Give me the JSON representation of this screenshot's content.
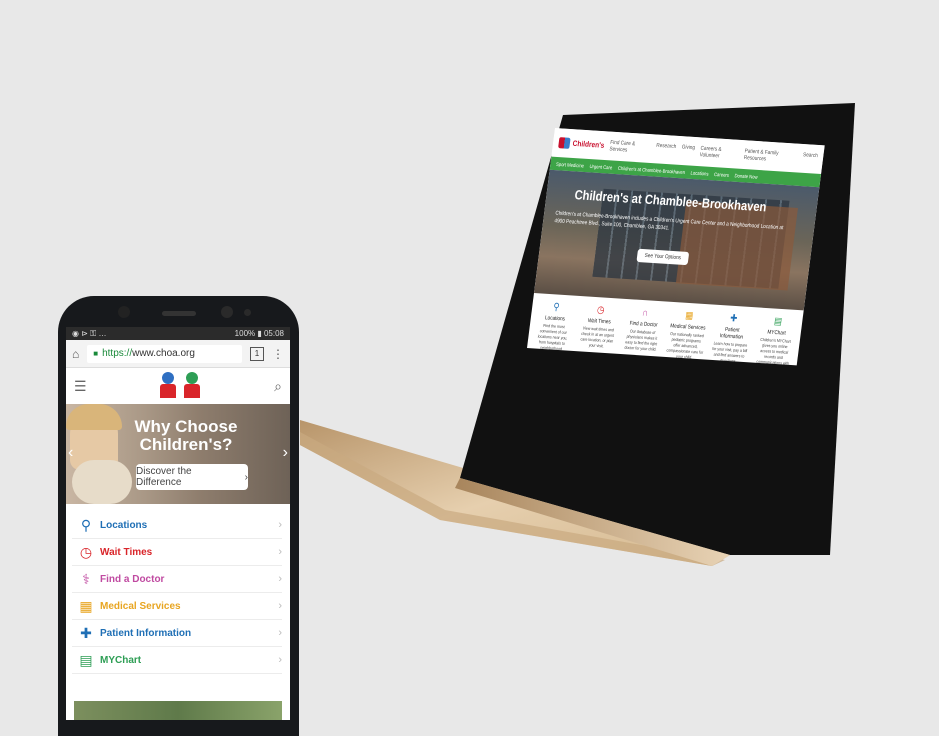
{
  "laptop": {
    "brand": "Children's",
    "nav": [
      "Find Care & Services",
      "Research",
      "Giving",
      "Careers & Volunteer",
      "Patient & Family Resources",
      "Search"
    ],
    "greenbar": [
      "Sport Medicine",
      "Urgent Care",
      "Children's at Chamblee-Brookhaven",
      "Locations",
      "Careers",
      "Donate Now"
    ],
    "hero": {
      "title": "Children's at Chamblee-Brookhaven",
      "text": "Children's at Chamblee-Brookhaven includes a Children's Urgent Care Center and a Neighborhood Location at 4900 Peachtree Blvd., Suite 100, Chamblee, GA 30341.",
      "cta": "See Your Options"
    },
    "columns": [
      {
        "icon": "location-icon",
        "glyph": "⚲",
        "color": "#1f6fb5",
        "title": "Locations",
        "desc": "Find the most convenient of our locations near you, from hospitals to neighborhood locations."
      },
      {
        "icon": "clock-icon",
        "glyph": "◷",
        "color": "#d9252a",
        "title": "Wait Times",
        "desc": "View wait times and check in at an urgent care location, or plan your visit."
      },
      {
        "icon": "stethoscope-icon",
        "glyph": "∩",
        "color": "#c04aa1",
        "title": "Find a Doctor",
        "desc": "Our database of physicians makes it easy to find the right doctor for your child."
      },
      {
        "icon": "building-icon",
        "glyph": "▦",
        "color": "#e8a521",
        "title": "Medical Services",
        "desc": "Our nationally ranked pediatric programs offer advanced, compassionate care for your child."
      },
      {
        "icon": "patient-icon",
        "glyph": "✚",
        "color": "#1f6fb5",
        "title": "Patient Information",
        "desc": "Learn how to prepare for your visit, pay a bill and find answers to questions."
      },
      {
        "icon": "clipboard-icon",
        "glyph": "▤",
        "color": "#2e9e55",
        "title": "MYChart",
        "desc": "Children's MYChart gives you online access to medical records and communications with your care team."
      }
    ]
  },
  "phone": {
    "status": {
      "left": "◉ ⊳ ⚿ …",
      "right": "100% ▮ 05:08"
    },
    "url": {
      "scheme": "https://",
      "host": "www.choa.org",
      "tabs": "1"
    },
    "hero": {
      "title": "Why Choose Children's?",
      "button": "Discover the Difference",
      "button_arrow": "›"
    },
    "menu": [
      {
        "label": "Locations",
        "color": "#1f6fb5",
        "glyph": "⚲",
        "icon": "location-icon"
      },
      {
        "label": "Wait Times",
        "color": "#d9252a",
        "glyph": "◷",
        "icon": "clock-icon"
      },
      {
        "label": "Find a Doctor",
        "color": "#c04aa1",
        "glyph": "⚕",
        "icon": "stethoscope-icon"
      },
      {
        "label": "Medical Services",
        "color": "#e8a521",
        "glyph": "▦",
        "icon": "building-icon"
      },
      {
        "label": "Patient Information",
        "color": "#1f6fb5",
        "glyph": "✚",
        "icon": "patient-icon"
      },
      {
        "label": "MYChart",
        "color": "#2e9e55",
        "glyph": "▤",
        "icon": "clipboard-icon"
      }
    ]
  }
}
